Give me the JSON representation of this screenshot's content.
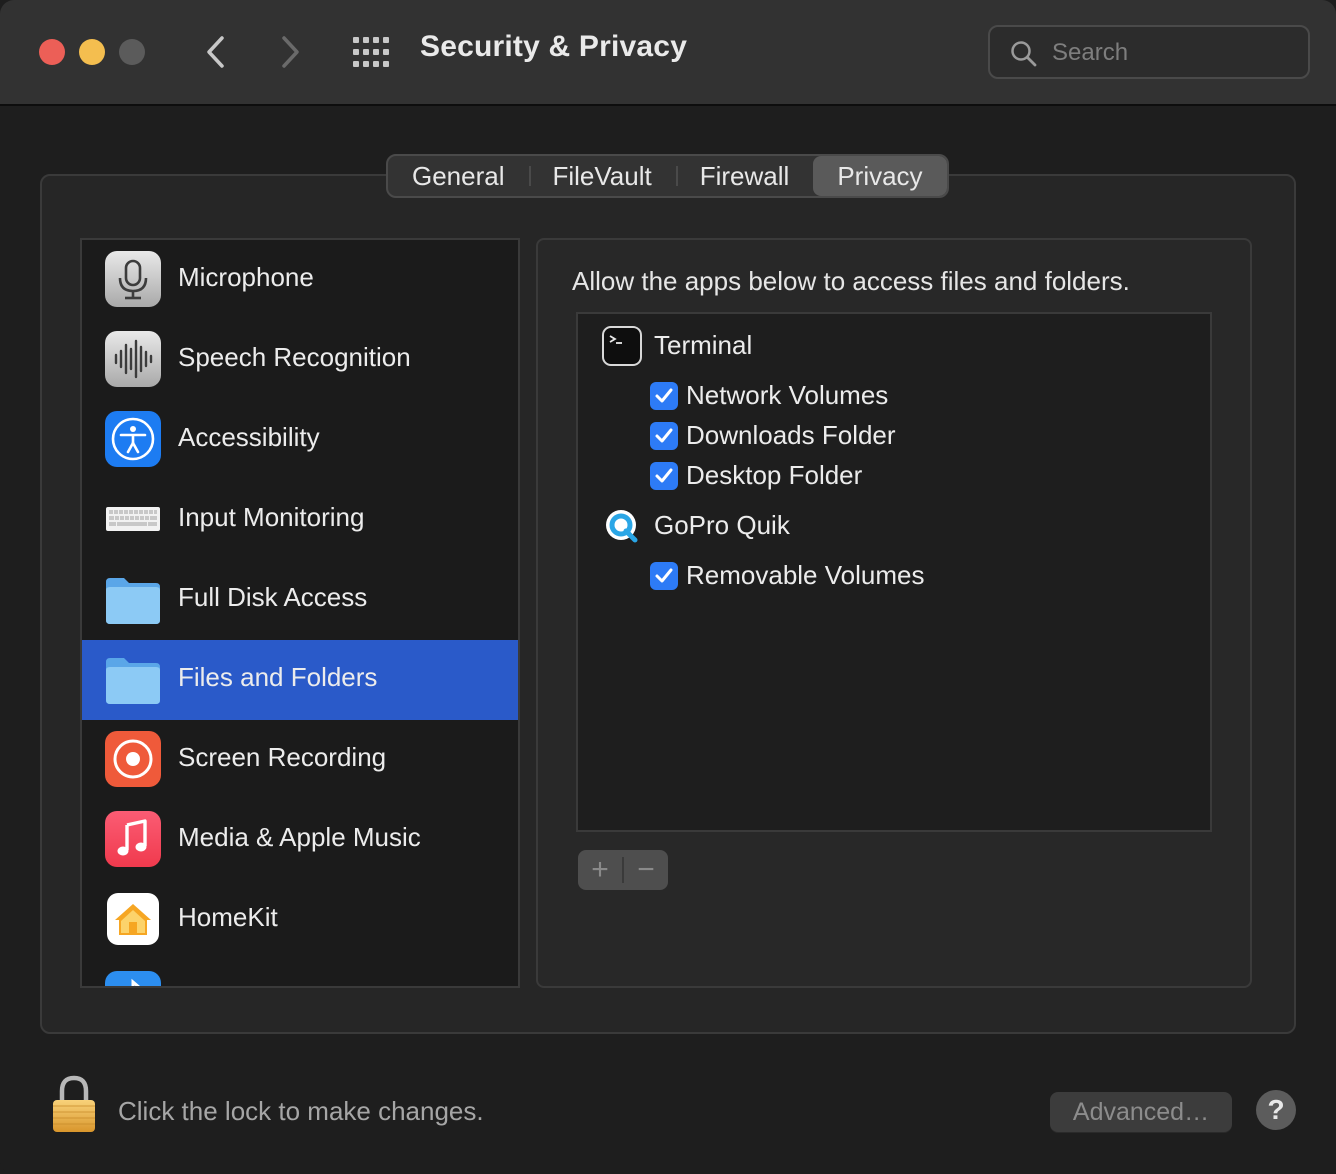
{
  "window": {
    "title": "Security & Privacy",
    "search_placeholder": "Search"
  },
  "tabs": [
    {
      "label": "General"
    },
    {
      "label": "FileVault"
    },
    {
      "label": "Firewall"
    },
    {
      "label": "Privacy",
      "active": true
    }
  ],
  "sidebar": {
    "items": [
      {
        "label": "Microphone",
        "icon": "microphone-icon"
      },
      {
        "label": "Speech Recognition",
        "icon": "waveform-icon"
      },
      {
        "label": "Accessibility",
        "icon": "accessibility-icon"
      },
      {
        "label": "Input Monitoring",
        "icon": "keyboard-icon"
      },
      {
        "label": "Full Disk Access",
        "icon": "folder-icon"
      },
      {
        "label": "Files and Folders",
        "icon": "folder-icon",
        "selected": true
      },
      {
        "label": "Screen Recording",
        "icon": "screen-record-icon"
      },
      {
        "label": "Media & Apple Music",
        "icon": "music-note-icon"
      },
      {
        "label": "HomeKit",
        "icon": "home-icon"
      }
    ]
  },
  "main": {
    "description": "Allow the apps below to access files and folders.",
    "apps": [
      {
        "name": "Terminal",
        "icon": "terminal-icon",
        "permissions": [
          {
            "label": "Network Volumes",
            "checked": true
          },
          {
            "label": "Downloads Folder",
            "checked": true
          },
          {
            "label": "Desktop Folder",
            "checked": true
          }
        ]
      },
      {
        "name": "GoPro Quik",
        "icon": "gopro-quik-icon",
        "permissions": [
          {
            "label": "Removable Volumes",
            "checked": true
          }
        ]
      }
    ],
    "add_label": "+",
    "remove_label": "−"
  },
  "footer": {
    "lock_text": "Click the lock to make changes.",
    "advanced_label": "Advanced…",
    "help_label": "?"
  },
  "colors": {
    "accent": "#2d7bf6",
    "selection": "#2a5ac9",
    "window_bg": "#1e1e1e",
    "titlebar_bg": "#323232"
  }
}
